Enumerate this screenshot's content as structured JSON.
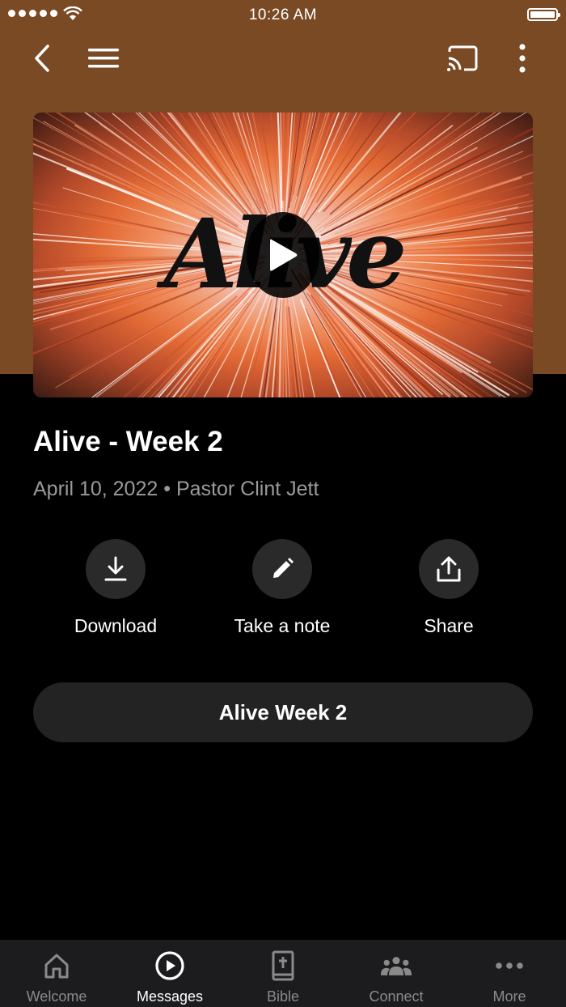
{
  "status_bar": {
    "time": "10:26 AM"
  },
  "hero": {
    "wordmark": "Alive"
  },
  "message": {
    "title": "Alive - Week 2",
    "date": "April 10, 2022",
    "separator": "•",
    "speaker": "Pastor Clint Jett"
  },
  "actions": [
    {
      "label": "Download",
      "icon": "download-icon"
    },
    {
      "label": "Take a note",
      "icon": "pencil-icon"
    },
    {
      "label": "Share",
      "icon": "share-icon"
    }
  ],
  "series_button": {
    "label": "Alive Week 2"
  },
  "tabs": [
    {
      "label": "Welcome",
      "icon": "home-icon",
      "active": false
    },
    {
      "label": "Messages",
      "icon": "play-circle-icon",
      "active": true
    },
    {
      "label": "Bible",
      "icon": "bible-icon",
      "active": false
    },
    {
      "label": "Connect",
      "icon": "people-icon",
      "active": false
    },
    {
      "label": "More",
      "icon": "more-dots-icon",
      "active": false
    }
  ],
  "colors": {
    "header_bg": "#7a4a25",
    "page_bg": "#000000",
    "button_bg": "#232323",
    "tabbar_bg": "#1c1c1e",
    "active_tab": "#ffffff",
    "inactive_tab": "#8a8a8a",
    "meta_text": "#9a9a9a"
  }
}
